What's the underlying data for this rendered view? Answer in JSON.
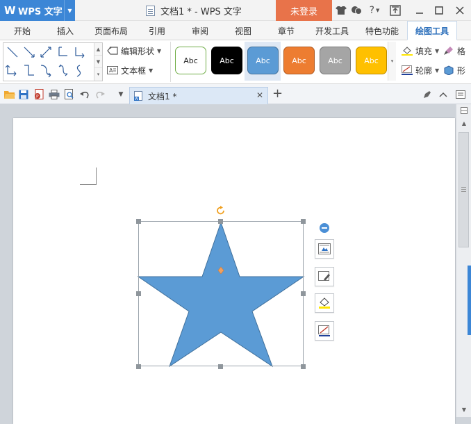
{
  "titlebar": {
    "app_name": "WPS 文字",
    "doc_title": "文档1 * - WPS 文字",
    "login_label": "未登录",
    "icons": [
      "skin-icon",
      "feedback-icon",
      "help-icon",
      "share-icon"
    ]
  },
  "menu": {
    "tabs": [
      {
        "label": "开始"
      },
      {
        "label": "插入"
      },
      {
        "label": "页面布局"
      },
      {
        "label": "引用"
      },
      {
        "label": "审阅"
      },
      {
        "label": "视图"
      },
      {
        "label": "章节"
      },
      {
        "label": "开发工具"
      },
      {
        "label": "特色功能"
      },
      {
        "label": "绘图工具",
        "active": true
      }
    ]
  },
  "ribbon": {
    "edit_shape_label": "编辑形状",
    "textbox_label": "文本框",
    "styles": [
      {
        "label": "Abc",
        "fill": "#ffffff",
        "border": "#70ad47",
        "text": "#222222"
      },
      {
        "label": "Abc",
        "fill": "#000000",
        "border": "#000000",
        "text": "#ffffff"
      },
      {
        "label": "Abc",
        "fill": "#5b9bd5",
        "border": "#41719c",
        "text": "#ffffff"
      },
      {
        "label": "Abc",
        "fill": "#ed7d31",
        "border": "#ae5a21",
        "text": "#ffffff"
      },
      {
        "label": "Abc",
        "fill": "#a5a5a5",
        "border": "#787878",
        "text": "#ffffff"
      },
      {
        "label": "Abc",
        "fill": "#ffc000",
        "border": "#bc8c00",
        "text": "#ffffff"
      }
    ],
    "fill_label": "填充",
    "outline_label": "轮廓",
    "cut_label_1": "格",
    "cut_label_2": "形"
  },
  "toolbar": {
    "doc_tab_label": "文档1 *"
  },
  "shape": {
    "type": "star-5",
    "fill": "#5b9bd5",
    "stroke": "#41719c"
  },
  "colors": {
    "accent": "#3c86d6",
    "login": "#e8734a"
  }
}
